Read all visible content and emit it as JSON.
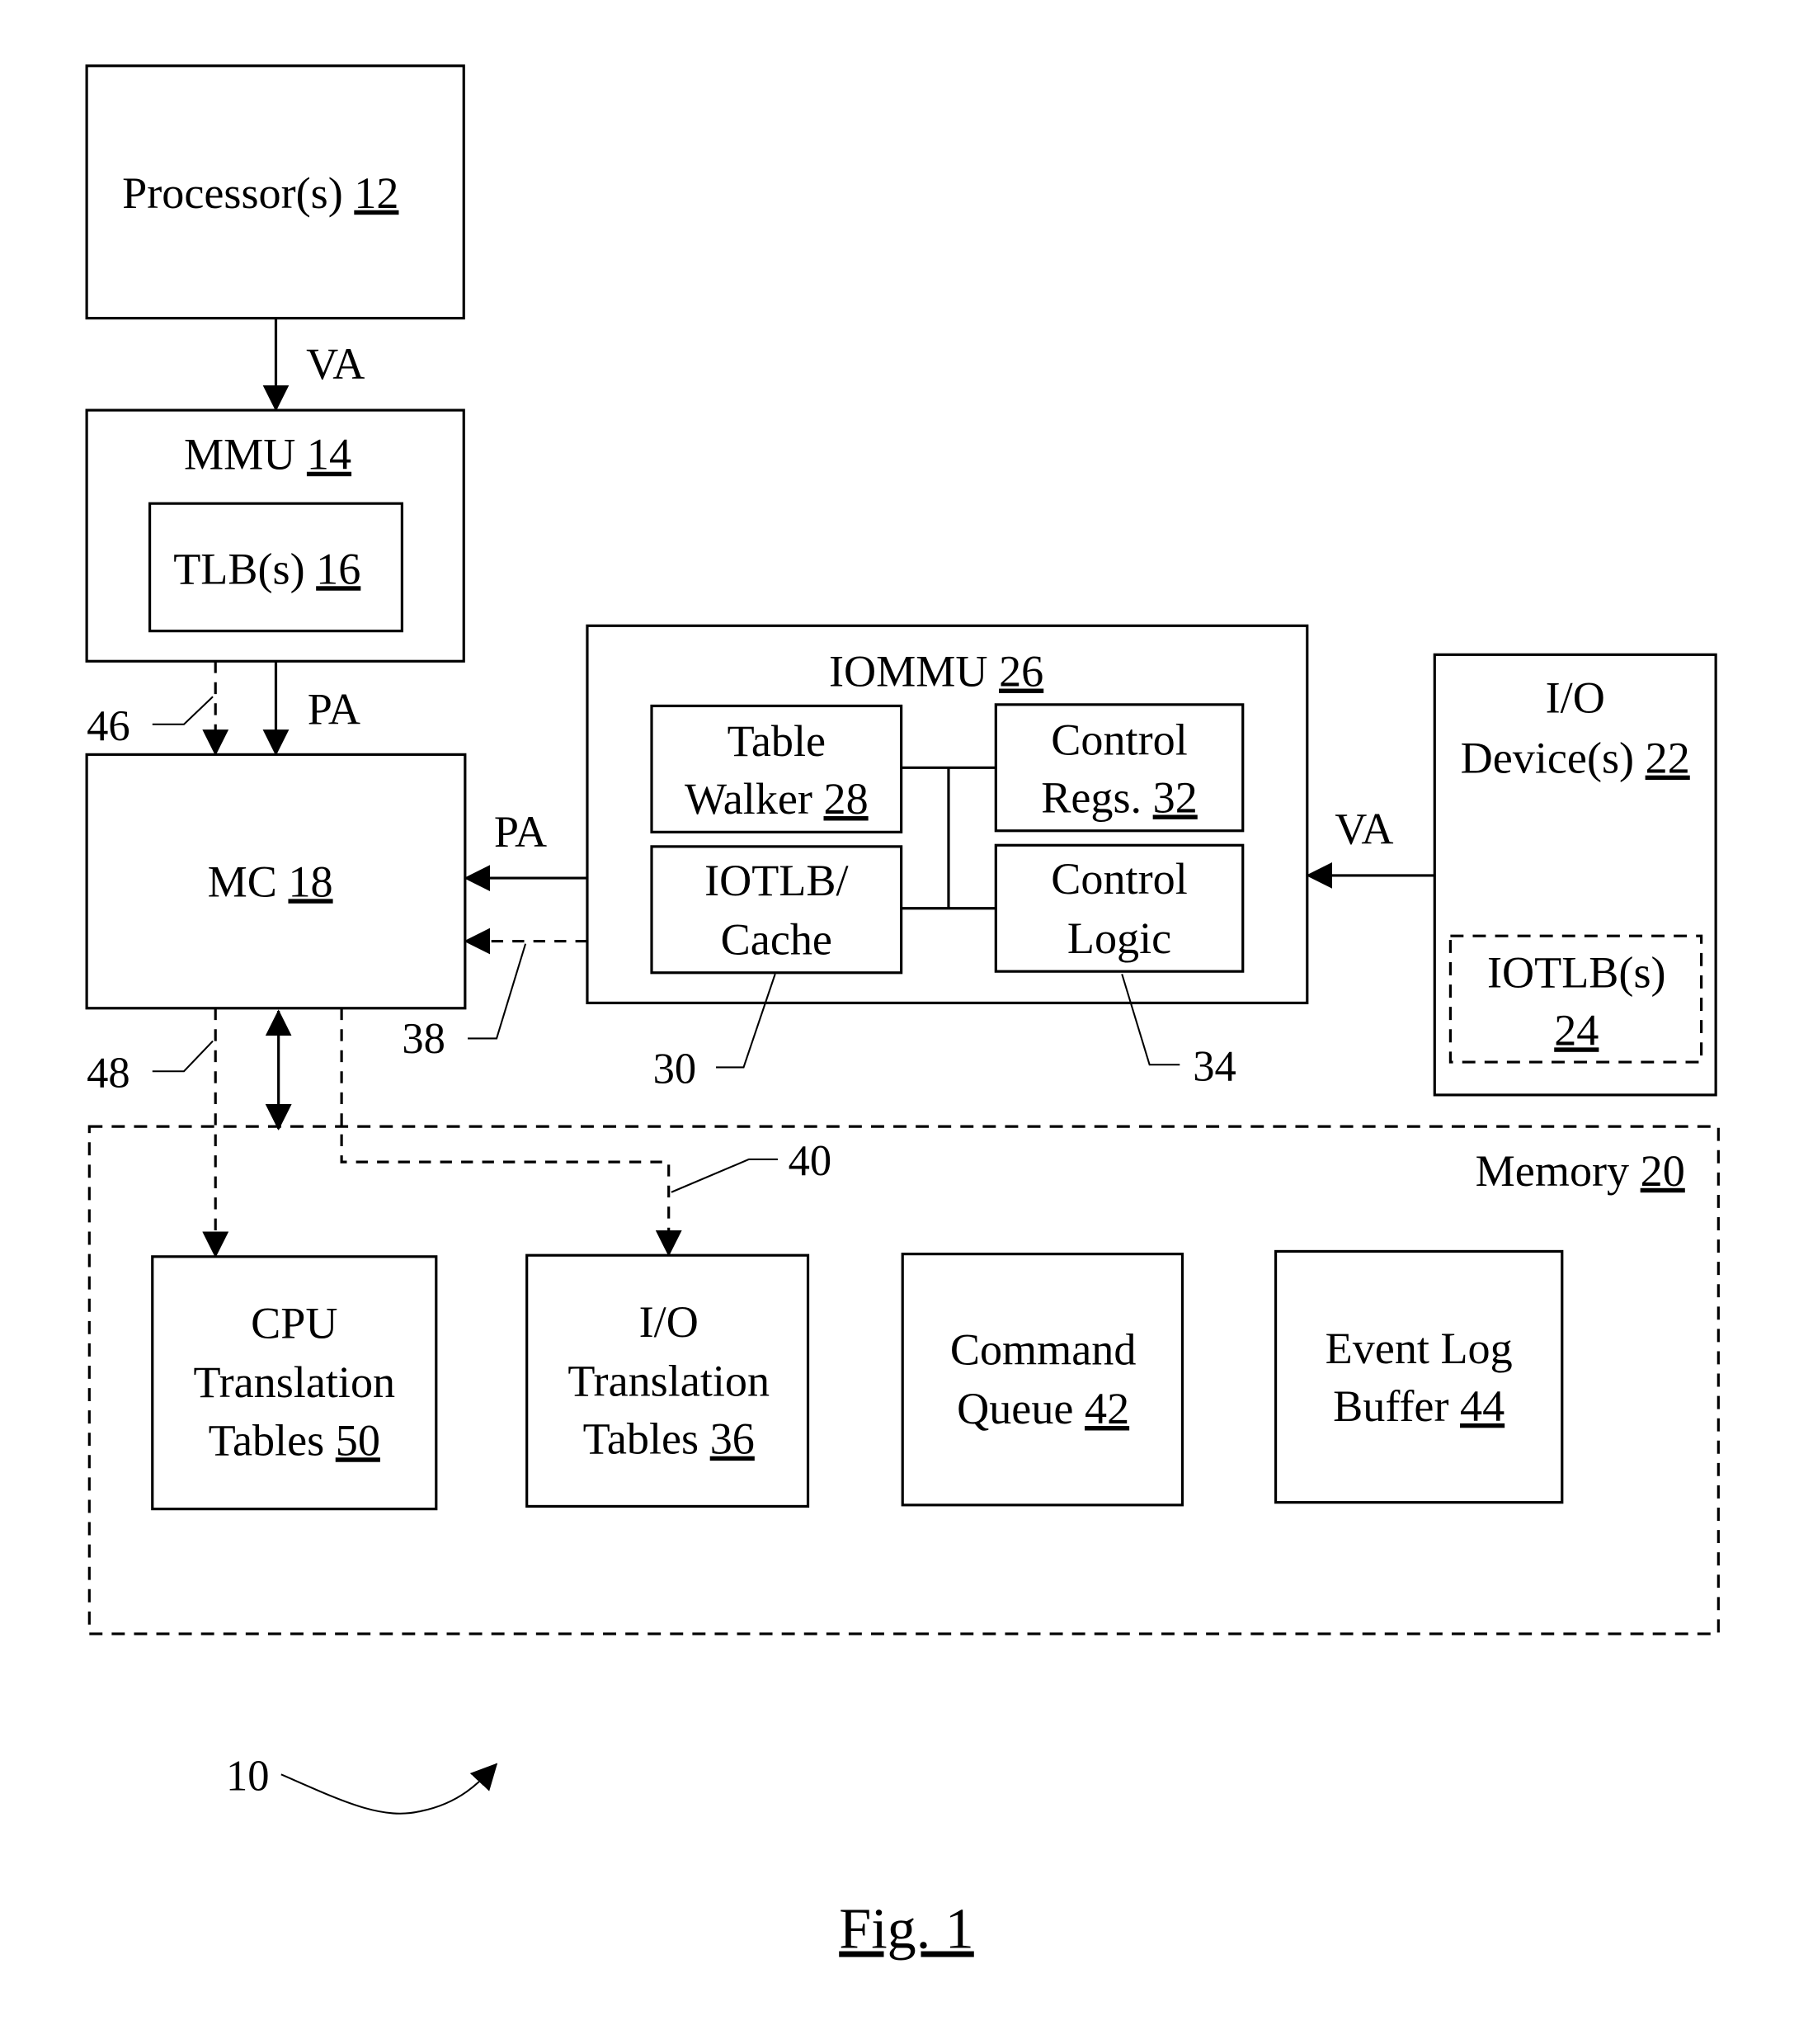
{
  "figure": {
    "caption": "Fig. 1",
    "system_ref": "10"
  },
  "blocks": {
    "processor": {
      "label": "Processor(s)",
      "ref": "12"
    },
    "mmu": {
      "label": "MMU",
      "ref": "14"
    },
    "tlb": {
      "label": "TLB(s)",
      "ref": "16"
    },
    "mc": {
      "label": "MC",
      "ref": "18"
    },
    "iommu": {
      "label": "IOMMU",
      "ref": "26"
    },
    "table_walker": {
      "line1": "Table",
      "line2": "Walker",
      "ref": "28"
    },
    "control_regs": {
      "line1": "Control",
      "line2": "Regs.",
      "ref": "32"
    },
    "iotlb_cache": {
      "line1": "IOTLB/",
      "line2": "Cache",
      "ref": "30"
    },
    "control_logic": {
      "line1": "Control",
      "line2": "Logic",
      "ref": "34"
    },
    "io_device": {
      "line1": "I/O",
      "line2": "Device(s)",
      "ref": "22"
    },
    "io_iotlb": {
      "label": "IOTLB(s)",
      "ref": "24"
    },
    "memory": {
      "label": "Memory",
      "ref": "20"
    },
    "cpu_tables": {
      "line1": "CPU",
      "line2": "Translation",
      "line3": "Tables",
      "ref": "50"
    },
    "io_tables": {
      "line1": "I/O",
      "line2": "Translation",
      "line3": "Tables",
      "ref": "36"
    },
    "command_queue": {
      "line1": "Command",
      "line2": "Queue",
      "ref": "42"
    },
    "event_log": {
      "line1": "Event Log",
      "line2": "Buffer",
      "ref": "44"
    }
  },
  "signals": {
    "proc_to_mmu": "VA",
    "mmu_to_mc": "PA",
    "iommu_to_mc": "PA",
    "io_to_iommu": "VA"
  },
  "refs": {
    "r46": "46",
    "r48": "48",
    "r38": "38",
    "r30": "30",
    "r34": "34",
    "r40": "40"
  }
}
